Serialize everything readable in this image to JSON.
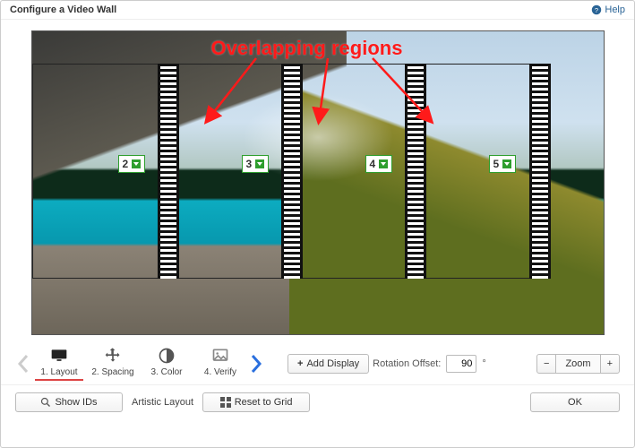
{
  "title": "Configure a Video Wall",
  "help_label": "Help",
  "annotation": "Overlapping regions",
  "panel_ids": [
    "2",
    "3",
    "4",
    "5"
  ],
  "steps": [
    {
      "label": "1. Layout",
      "icon": "monitor",
      "active": true
    },
    {
      "label": "2. Spacing",
      "icon": "move",
      "active": false
    },
    {
      "label": "3. Color",
      "icon": "contrast",
      "active": false
    },
    {
      "label": "4. Verify",
      "icon": "image",
      "active": false
    }
  ],
  "toolbar": {
    "add_display": "Add Display",
    "rotation_label": "Rotation Offset:",
    "rotation_value": "90",
    "rotation_unit": "°",
    "zoom_label": "Zoom",
    "zoom_minus": "−",
    "zoom_plus": "+"
  },
  "bottom": {
    "show_ids": "Show IDs",
    "artistic": "Artistic Layout",
    "reset": "Reset to Grid",
    "ok": "OK"
  }
}
